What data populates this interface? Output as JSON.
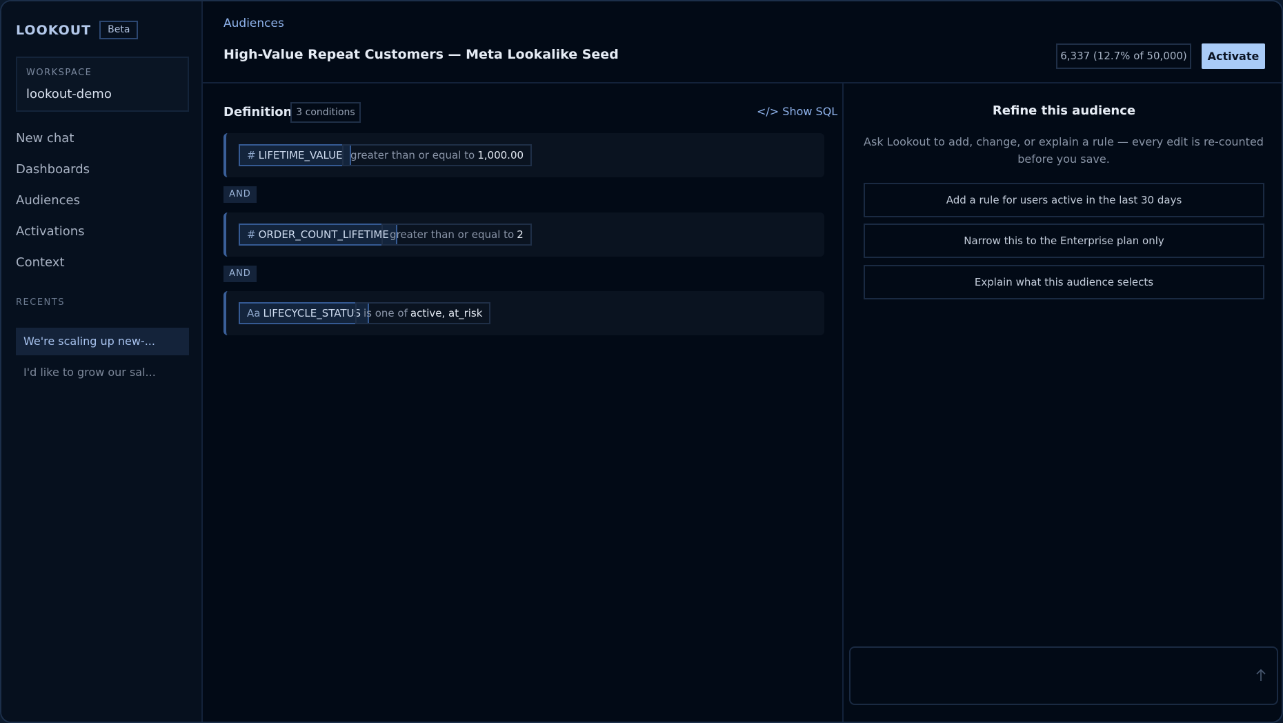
{
  "app": {
    "name": "LOOKOUT",
    "badge": "Beta"
  },
  "workspace": {
    "label": "WORKSPACE",
    "value": "lookout-demo"
  },
  "nav": {
    "items": [
      {
        "label": "New chat"
      },
      {
        "label": "Dashboards"
      },
      {
        "label": "Audiences"
      },
      {
        "label": "Activations"
      },
      {
        "label": "Context"
      }
    ]
  },
  "recents": {
    "label": "RECENTS",
    "items": [
      {
        "label": "We're scaling up new-...",
        "active": true
      },
      {
        "label": "I'd like to grow our sal...",
        "active": false
      }
    ]
  },
  "header": {
    "breadcrumb": "Audiences",
    "title": "High-Value Repeat Customers — Meta Lookalike Seed",
    "count": "6,337 (12.7% of 50,000)",
    "activate_label": "Activate"
  },
  "definition": {
    "title": "Definition",
    "condition_count": "3 conditions",
    "show_sql": "</> Show SQL",
    "conjunction": "AND",
    "conditions": [
      {
        "type_icon": "#",
        "field": "LIFETIME_VALUE",
        "operator": "greater than or equal to",
        "value": "1,000.00"
      },
      {
        "type_icon": "#",
        "field": "ORDER_COUNT_LIFETIME",
        "operator": "greater than or equal to",
        "value": "2"
      },
      {
        "type_icon": "Aa",
        "field": "LIFECYCLE_STATUS",
        "operator": "is one of",
        "value": "active, at_risk"
      }
    ]
  },
  "refine": {
    "title": "Refine this audience",
    "description": "Ask Lookout to add, change, or explain a rule — every edit is re-counted before you save.",
    "suggestions": [
      "Add a rule for users active in the last 30 days",
      "Narrow this to the Enterprise plan only",
      "Explain what this audience selects"
    ],
    "input_placeholder": ""
  },
  "colors": {
    "background": "#020a16",
    "sidebar": "#06101e",
    "accent": "#a9cbf7",
    "link": "#8fb3ec"
  }
}
